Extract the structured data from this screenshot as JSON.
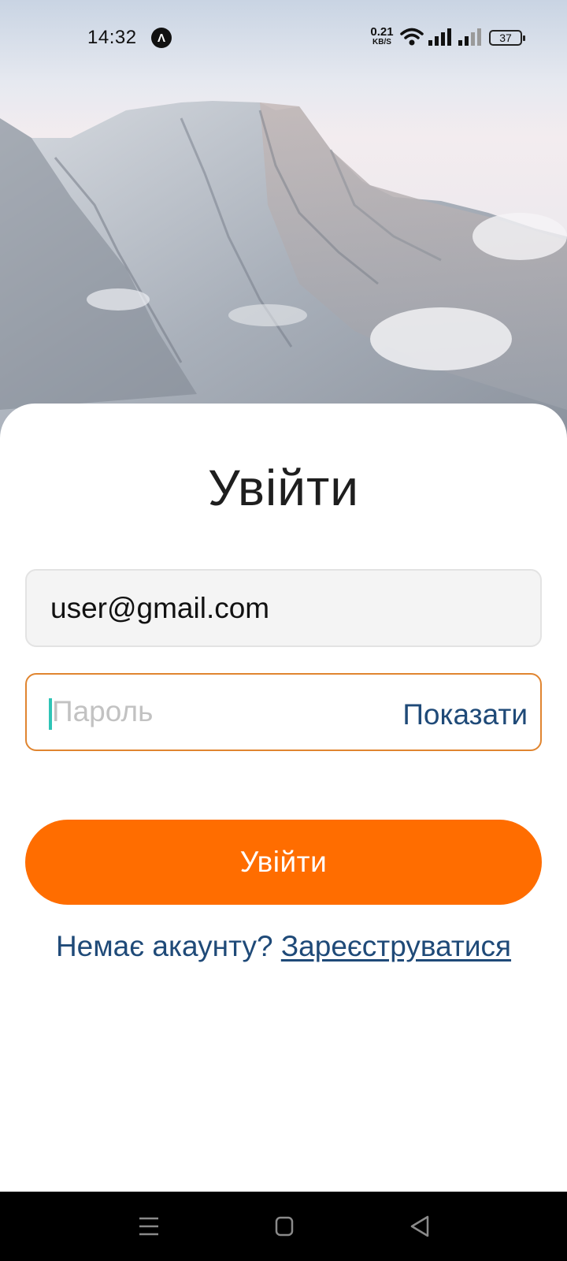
{
  "status_bar": {
    "time": "14:32",
    "app_icon_glyph": "Λ",
    "net_speed_value": "0.21",
    "net_speed_unit": "KB/S",
    "battery_level": "37"
  },
  "login": {
    "title": "Увійти",
    "email_value": "user@gmail.com",
    "password_placeholder": "Пароль",
    "show_password_label": "Показати",
    "submit_label": "Увійти",
    "no_account_text": "Немає акаунту?",
    "register_link": "Зареєструватися"
  },
  "colors": {
    "accent": "#ff6d00",
    "link": "#1f4a78",
    "focus_border": "#e08530",
    "caret": "#2ec4b6"
  },
  "icons": {
    "status": [
      "app-notification-icon",
      "wifi-icon",
      "signal-icon",
      "signal-icon",
      "battery-icon"
    ],
    "navigation": [
      "menu-icon",
      "home-icon",
      "back-icon"
    ]
  }
}
